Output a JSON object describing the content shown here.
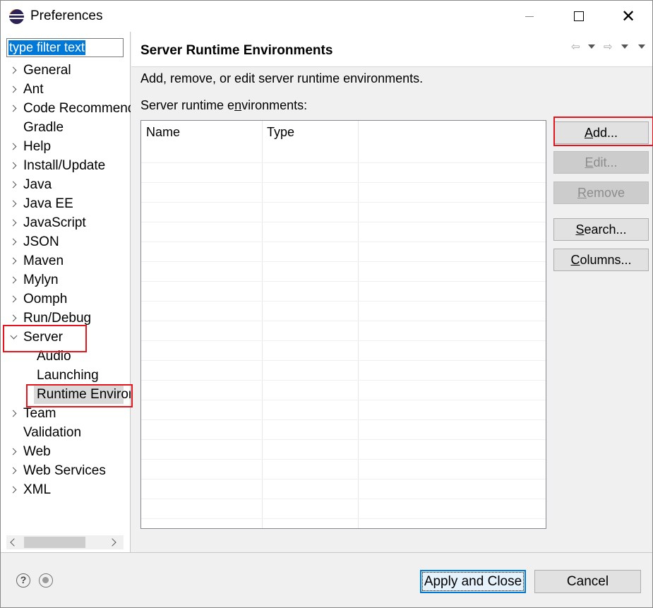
{
  "window": {
    "title": "Preferences"
  },
  "filter": {
    "text": "type filter text"
  },
  "tree": [
    {
      "label": "General",
      "state": "collapsed"
    },
    {
      "label": "Ant",
      "state": "collapsed"
    },
    {
      "label": "Code Recommenders",
      "state": "collapsed"
    },
    {
      "label": "Gradle",
      "state": "none"
    },
    {
      "label": "Help",
      "state": "collapsed"
    },
    {
      "label": "Install/Update",
      "state": "collapsed"
    },
    {
      "label": "Java",
      "state": "collapsed"
    },
    {
      "label": "Java EE",
      "state": "collapsed"
    },
    {
      "label": "JavaScript",
      "state": "collapsed"
    },
    {
      "label": "JSON",
      "state": "collapsed"
    },
    {
      "label": "Maven",
      "state": "collapsed"
    },
    {
      "label": "Mylyn",
      "state": "collapsed"
    },
    {
      "label": "Oomph",
      "state": "collapsed"
    },
    {
      "label": "Run/Debug",
      "state": "collapsed"
    },
    {
      "label": "Server",
      "state": "expanded"
    },
    {
      "label": "Audio",
      "state": "child"
    },
    {
      "label": "Launching",
      "state": "child"
    },
    {
      "label": "Runtime Environments",
      "state": "child-selected"
    },
    {
      "label": "Team",
      "state": "collapsed"
    },
    {
      "label": "Validation",
      "state": "none"
    },
    {
      "label": "Web",
      "state": "collapsed"
    },
    {
      "label": "Web Services",
      "state": "collapsed"
    },
    {
      "label": "XML",
      "state": "collapsed"
    }
  ],
  "page": {
    "title": "Server Runtime Environments",
    "description": "Add, remove, or edit server runtime environments.",
    "list_label_pre": "Server runtime e",
    "list_label_mnemonic": "n",
    "list_label_post": "vironments:",
    "columns": [
      "Name",
      "Type"
    ]
  },
  "buttons": {
    "add": {
      "mnemonic": "A",
      "rest": "dd..."
    },
    "edit": {
      "mnemonic": "E",
      "rest": "dit..."
    },
    "remove": {
      "mnemonic": "R",
      "rest": "emove"
    },
    "search": {
      "mnemonic": "S",
      "rest": "earch..."
    },
    "columns": {
      "mnemonic": "C",
      "rest": "olumns..."
    }
  },
  "footer": {
    "help_glyph": "?",
    "apply_close": "Apply and Close",
    "cancel": "Cancel"
  },
  "colors": {
    "accent": "#0078d7",
    "highlight": "#e8141b"
  }
}
